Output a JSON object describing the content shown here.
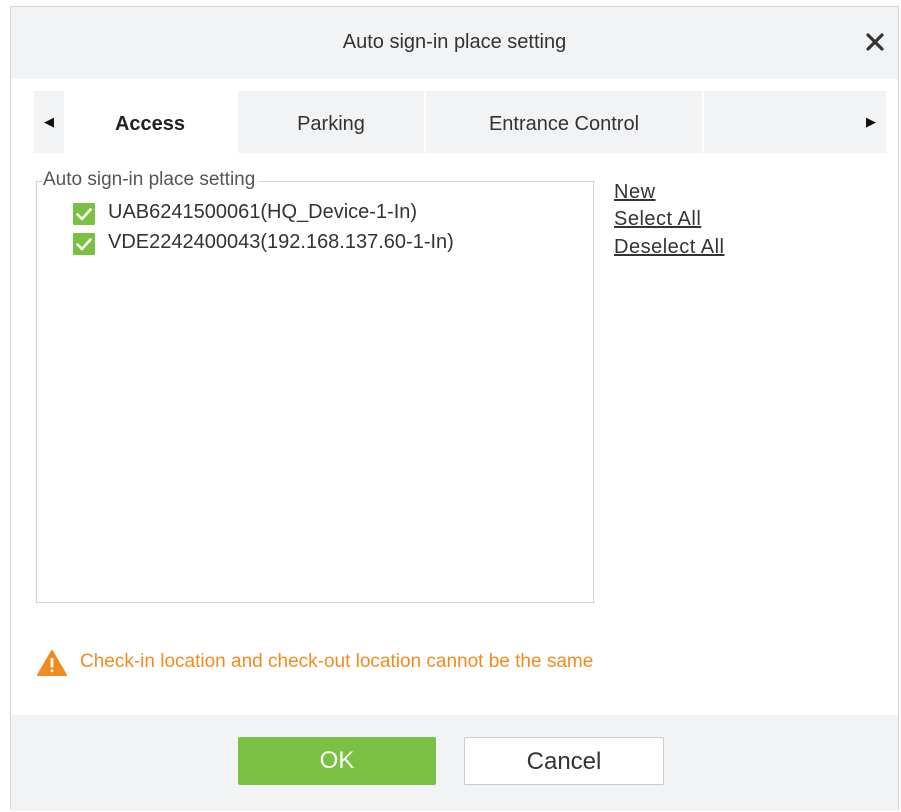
{
  "dialog": {
    "title": "Auto sign-in place setting",
    "close_glyph": "✕",
    "close_icon": "close-icon"
  },
  "tabs": {
    "scroll_left_glyph": "◀",
    "scroll_right_glyph": "▶",
    "items": [
      {
        "label": "Access",
        "active": true
      },
      {
        "label": "Parking",
        "active": false
      },
      {
        "label": "Entrance Control",
        "active": false
      }
    ]
  },
  "panel": {
    "legend": "Auto sign-in place setting",
    "devices": [
      {
        "label": "UAB6241500061(HQ_Device-1-In)",
        "checked": true
      },
      {
        "label": "VDE2242400043(192.168.137.60-1-In)",
        "checked": true
      }
    ]
  },
  "actions": {
    "new_label": "New",
    "select_all_label": "Select All",
    "deselect_all_label": "Deselect All"
  },
  "warning": {
    "icon": "warning-triangle-icon",
    "text": "Check-in location and check-out location cannot be the same"
  },
  "footer": {
    "ok_label": "OK",
    "cancel_label": "Cancel"
  },
  "colors": {
    "accent_green": "#7ac143",
    "warning_orange": "#f08c1d",
    "header_bg": "#f2f3f5"
  }
}
